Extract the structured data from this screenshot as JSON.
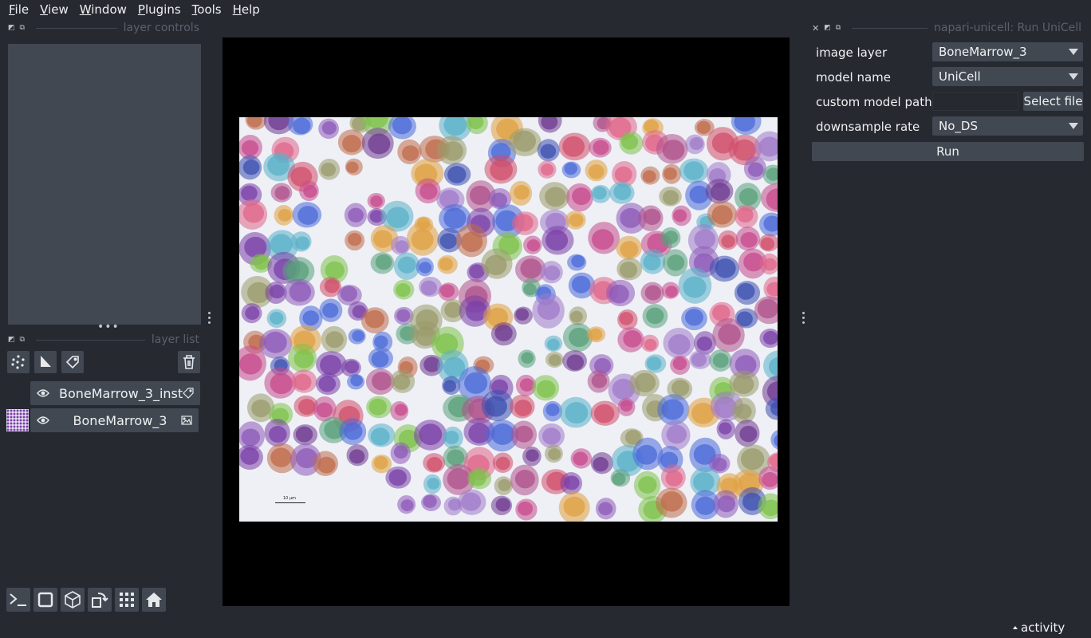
{
  "menu": [
    "File",
    "View",
    "Window",
    "Plugins",
    "Tools",
    "Help"
  ],
  "left_dock": {
    "controls_title": "layer controls",
    "list_title": "layer list",
    "layers": [
      {
        "name": "BoneMarrow_3_inst",
        "type_icon": "label-tag-icon"
      },
      {
        "name": "BoneMarrow_3",
        "type_icon": "image-icon"
      }
    ],
    "layer_buttons": [
      "new-points-layer-icon",
      "new-shapes-layer-icon",
      "new-labels-layer-icon",
      "delete-layer-icon"
    ],
    "bottom_buttons": [
      "console-icon",
      "ndisplay-2d-icon",
      "3d-cube-icon",
      "roll-dimensions-icon",
      "grid-mode-icon",
      "home-icon"
    ]
  },
  "plugin": {
    "title": "napari-unicell: Run UniCell",
    "fields": {
      "image_layer": {
        "label": "image layer",
        "value": "BoneMarrow_3"
      },
      "model_name": {
        "label": "model name",
        "value": "UniCell"
      },
      "custom_model_path": {
        "label": "custom model path",
        "value": "",
        "button": "Select file"
      },
      "downsample_rate": {
        "label": "downsample rate",
        "value": "No_DS"
      }
    },
    "run_label": "Run"
  },
  "canvas": {
    "scalebar_text": "10 µm",
    "cell_palette": [
      "#c74a8c",
      "#7a3fa8",
      "#4b6ad8",
      "#7dc24a",
      "#e0668a",
      "#5ab0c8",
      "#8e5ab8",
      "#c06b4a",
      "#9a9a6a",
      "#d14d6a",
      "#6f3a8f",
      "#a07ac8",
      "#58a07a",
      "#e0a040",
      "#3c4fb0",
      "#b0508a"
    ]
  },
  "status": {
    "activity_label": "activity"
  }
}
